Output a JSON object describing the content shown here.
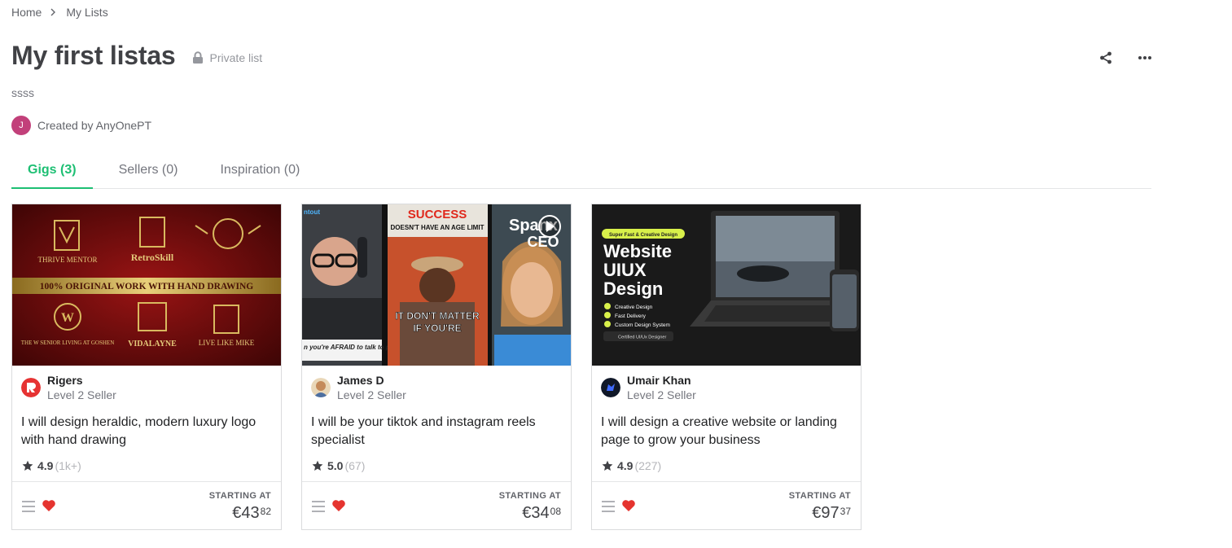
{
  "breadcrumb": {
    "home": "Home",
    "current": "My Lists"
  },
  "list": {
    "title": "My first listas",
    "privacy": "Private list",
    "description": "ssss",
    "creator_initial": "J",
    "created_by": "Created by AnyOnePT"
  },
  "tabs": [
    {
      "label": "Gigs (3)",
      "active": true
    },
    {
      "label": "Sellers (0)",
      "active": false
    },
    {
      "label": "Inspiration (0)",
      "active": false
    }
  ],
  "icons": {
    "share": "share-icon",
    "more": "more-horizontal-icon",
    "lock": "lock-icon",
    "list": "list-icon",
    "heart": "heart-icon",
    "star": "star-icon",
    "play": "play-icon"
  },
  "colors": {
    "accent": "#1dbf73",
    "heart": "#e5342f",
    "creator_avatar": "#c2407a"
  },
  "gigs": [
    {
      "seller": "Rigers",
      "level": "Level 2 Seller",
      "title": "I will design heraldic, modern luxury logo with hand drawing",
      "score": "4.9",
      "reviews": "(1k+)",
      "starting_label": "STARTING AT",
      "price_main": "€43",
      "price_cents": "82",
      "image_text": {
        "logo1": "THRIVE MENTOR",
        "logo2": "RetroSkill",
        "banner": "100% ORIGINAL WORK WITH HAND DRAWING",
        "logo3": "THE W SENIOR LIVING AT GOSHEN",
        "logo4": "VIDALAYNE",
        "logo5": "LIVE LIKE MIKE"
      }
    },
    {
      "seller": "James D",
      "level": "Level 2 Seller",
      "title": "I will be your tiktok and instagram reels specialist",
      "score": "5.0",
      "reviews": "(67)",
      "starting_label": "STARTING AT",
      "price_main": "€34",
      "price_cents": "08",
      "image_text": {
        "tag": "ntout",
        "success": "SUCCESS",
        "age": "DOESN'T HAVE AN AGE LIMIT",
        "matter1": "IT DON'T MATTER",
        "matter2": "IF YOU'RE",
        "afraid": "n you're AFRAID to talk to people",
        "spanx": "Spanx",
        "ceo": "CEO"
      }
    },
    {
      "seller": "Umair Khan",
      "level": "Level 2 Seller",
      "title": "I will design a creative website or landing page to grow your business",
      "score": "4.9",
      "reviews": "(227)",
      "starting_label": "STARTING AT",
      "price_main": "€97",
      "price_cents": "37",
      "image_text": {
        "pill": "Super Fast & Creative Design",
        "line1": "Website",
        "line2": "UIUX",
        "line3": "Design",
        "bullet1": "Creative Design",
        "bullet2": "Fast Delivery",
        "bullet3": "Custom Design System",
        "badge": "Certified UI/Ux Designer"
      }
    }
  ]
}
